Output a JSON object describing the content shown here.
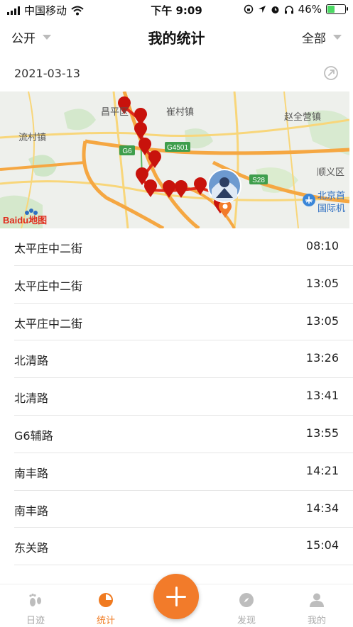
{
  "status_bar": {
    "carrier": "中国移动",
    "time": "下午 9:09",
    "battery_percent": "46%",
    "battery_level": 0.46
  },
  "header": {
    "left_filter": "公开",
    "title": "我的统计",
    "right_filter": "全部"
  },
  "date": "2021-03-13",
  "map": {
    "place_labels": [
      "昌平区",
      "崔村镇",
      "赵全营镇",
      "流村镇",
      "顺义区",
      "北京首",
      "国际机"
    ],
    "road_labels": [
      "G6",
      "G4501",
      "S28"
    ],
    "logo": "Baidu地图"
  },
  "records": [
    {
      "place": "太平庄中二街",
      "time": "08:10"
    },
    {
      "place": "太平庄中二街",
      "time": "13:05"
    },
    {
      "place": "太平庄中二街",
      "time": "13:05"
    },
    {
      "place": "北清路",
      "time": "13:26"
    },
    {
      "place": "北清路",
      "time": "13:41"
    },
    {
      "place": "G6辅路",
      "time": "13:55"
    },
    {
      "place": "南丰路",
      "time": "14:21"
    },
    {
      "place": "南丰路",
      "time": "14:34"
    },
    {
      "place": "东关路",
      "time": "15:04"
    }
  ],
  "tabs": [
    {
      "label": "日迹",
      "icon": "footprint-icon"
    },
    {
      "label": "统计",
      "icon": "stats-icon"
    },
    {
      "label": "发现",
      "icon": "compass-icon"
    },
    {
      "label": "我的",
      "icon": "profile-icon"
    }
  ],
  "colors": {
    "accent": "#f27b2a",
    "route": "#e02a1a",
    "marker": "#c8120c"
  }
}
